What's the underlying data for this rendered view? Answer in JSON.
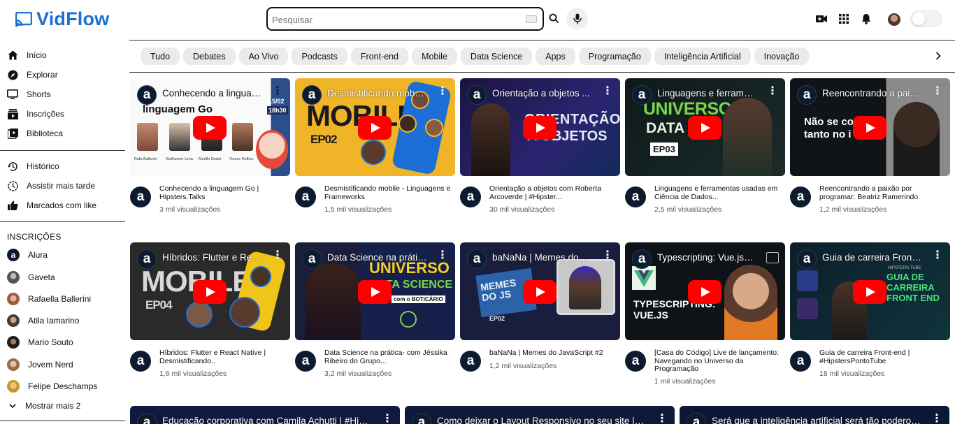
{
  "app": {
    "name": "VidFlow",
    "brand_color": "#1d6fd0"
  },
  "search": {
    "placeholder": "Pesquisar",
    "value": ""
  },
  "header_icons": [
    "create-video-icon",
    "apps-grid-icon",
    "notifications-bell-icon",
    "user-avatar",
    "theme-toggle"
  ],
  "sidebar": {
    "main": [
      {
        "label": "Início",
        "icon": "home-icon"
      },
      {
        "label": "Explorar",
        "icon": "compass-icon"
      },
      {
        "label": "Shorts",
        "icon": "shorts-icon"
      },
      {
        "label": "Inscrições",
        "icon": "subscriptions-icon"
      },
      {
        "label": "Biblioteca",
        "icon": "library-icon"
      }
    ],
    "secondary": [
      {
        "label": "Histórico",
        "icon": "history-icon"
      },
      {
        "label": "Assistir mais tarde",
        "icon": "watch-later-icon"
      },
      {
        "label": "Marcados com like",
        "icon": "thumbs-up-icon"
      }
    ],
    "subscriptions_title": "INSCRIÇÕES",
    "subscriptions": [
      {
        "label": "Alura",
        "color": "#0c1b2e"
      },
      {
        "label": "Gaveta",
        "color": "#6b6b6b"
      },
      {
        "label": "Rafaella Ballerini",
        "color": "#c98a72"
      },
      {
        "label": "Atila Iamarino",
        "color": "#7a5a44"
      },
      {
        "label": "Mario Souto",
        "color": "#3b3b3b"
      },
      {
        "label": "Jovem Nerd",
        "color": "#b8866b"
      },
      {
        "label": "Felipe Deschamps",
        "color": "#e0b64a"
      }
    ],
    "show_more": "Mostrar mais 2"
  },
  "chips": [
    "Tudo",
    "Debates",
    "Ao Vivo",
    "Podcasts",
    "Front-end",
    "Mobile",
    "Data Science",
    "Apps",
    "Programação",
    "Inteligência Artificial",
    "Inovação"
  ],
  "videos_row1": [
    {
      "thumb_title": "Conhecendo a lingua…",
      "title": "Conhecendo a linguagem Go | Hipsters.Talks",
      "views": "3 mil visualizações"
    },
    {
      "thumb_title": "Desmistificando mob…",
      "title": "Desmistificando mobile - Linguagens e Frameworks",
      "views": "1,5 mil visualizações"
    },
    {
      "thumb_title": "Orientação a objetos ...",
      "title": "Orientação a objetos com Roberta Arcoverde | #Hipster...",
      "views": "30 mil visualizações"
    },
    {
      "thumb_title": "Linguagens e ferram…",
      "title": "Linguagens e ferramentas usadas em Ciência de Dados...",
      "views": "2,5 mil visualizações"
    },
    {
      "thumb_title": "Reencontrando a pai…",
      "title": "Reencontrando a paixão por programar: Beatriz Ramerindo",
      "views": "1,2 mil visualizações"
    }
  ],
  "videos_row2": [
    {
      "thumb_title": "Híbridos: Flutter e Re…",
      "title": "Híbridos: Flutter e React Native | Desmistificando..",
      "views": "1,6 mil visualizações"
    },
    {
      "thumb_title": "Data Science na práti…",
      "title": "Data Science na prática- com Jéssika Ribeiro do Grupo...",
      "views": "3,2 mil visualizações"
    },
    {
      "thumb_title": "baNaNa | Memes do…",
      "title": "baNaNa | Memes do JavaScript #2",
      "views": "1,2 mil visualizações"
    },
    {
      "thumb_title": "Typescripting: Vue.js …",
      "title": "[Casa do Código] Live de lançamento: Navegando no Universo da Programação",
      "views": "1 mil visualizações"
    },
    {
      "thumb_title": "Guia de carreira Fron…",
      "title": "Guia de carreira Front-end | #HipstersPontoTube",
      "views": "18 mil visualizações"
    }
  ],
  "videos_row3": [
    {
      "thumb_title": "Educação corporativa com Camila Achutti | #Hi…"
    },
    {
      "thumb_title": "Como deixar o Layout Responsivo no seu site |…"
    },
    {
      "thumb_title": "Será que a inteligência artificial será tão podero…"
    }
  ],
  "thumb_texts": {
    "go_heading": "linguagem Go",
    "go_date": "15/02",
    "go_time": "18h30",
    "go_names": [
      "Rafa Ballerini",
      "Guilherme Lima",
      "Murillo Godoi",
      "Yonice Rollins"
    ],
    "mobile_word": "MOBILE",
    "mobile_ep2": "EP02",
    "oo_word1": "ORIENTAÇÃO",
    "oo_word2": "A OBJETOS",
    "uds_word1": "UNIVERSO",
    "uds_word2": "DATA SC",
    "uds_ep": "EP03",
    "beatriz_text1": "Não se co",
    "beatriz_text2": "tanto no i",
    "mobile_ep4": "EP04",
    "ds_word1": "UNIVERSO",
    "ds_word2": "DATA SCIENCE",
    "ds_sponsor": "com o BOTICÁRIO",
    "memes_word": "MEMES DO JS",
    "memes_ep": "EP02",
    "ts_word1": "TYPESCRIPTING:",
    "ts_word2": "VUE.JS",
    "guia_brand": "HIPSTERS.TUBE",
    "guia_word": "GUIA DE CARREIRA FRONT END"
  }
}
